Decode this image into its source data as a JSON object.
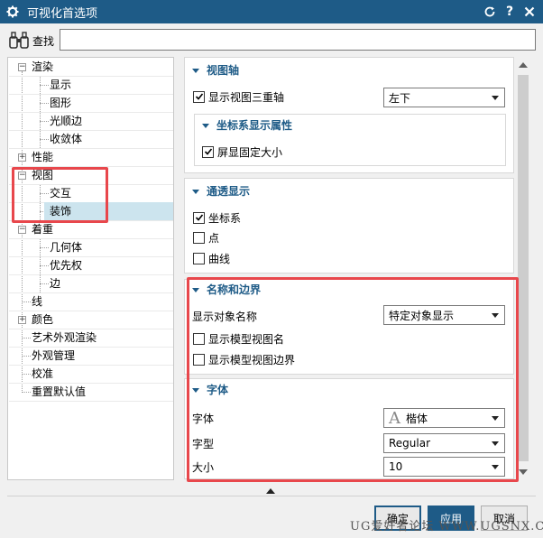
{
  "window": {
    "title": "可视化首选项"
  },
  "search": {
    "label": "查找",
    "value": "",
    "placeholder": ""
  },
  "tree": {
    "items": [
      {
        "label": "渲染"
      },
      {
        "label": "显示"
      },
      {
        "label": "图形"
      },
      {
        "label": "光顺边"
      },
      {
        "label": "收敛体"
      },
      {
        "label": "性能"
      },
      {
        "label": "视图"
      },
      {
        "label": "交互"
      },
      {
        "label": "装饰"
      },
      {
        "label": "着重"
      },
      {
        "label": "几何体"
      },
      {
        "label": "优先权"
      },
      {
        "label": "边"
      },
      {
        "label": "线"
      },
      {
        "label": "颜色"
      },
      {
        "label": "艺术外观渲染"
      },
      {
        "label": "外观管理"
      },
      {
        "label": "校准"
      },
      {
        "label": "重置默认值"
      }
    ]
  },
  "panel": {
    "view_triad": {
      "header": "视图轴",
      "show_triad_label": "显示视图三重轴",
      "position_value": "左下",
      "coord": {
        "header": "坐标系显示属性",
        "fixed_size_label": "屏显固定大小"
      }
    },
    "see_through": {
      "header": "通透显示",
      "csys_label": "坐标系",
      "point_label": "点",
      "curve_label": "曲线"
    },
    "names_borders": {
      "header": "名称和边界",
      "show_name_label": "显示对象名称",
      "show_name_value": "特定对象显示",
      "model_view_name_label": "显示模型视图名",
      "model_view_border_label": "显示模型视图边界"
    },
    "font": {
      "header": "字体",
      "font_label": "字体",
      "font_value": "楷体",
      "style_label": "字型",
      "style_value": "Regular",
      "size_label": "大小",
      "size_value": "10"
    }
  },
  "buttons": {
    "ok": "确定",
    "apply": "应用",
    "cancel": "取消"
  },
  "watermark": "UG爱好者论坛 WWW.UGSNX.COM",
  "colors": {
    "titlebar": "#1e5b87",
    "accent": "#1e5b87",
    "highlight_box": "#e8474c",
    "selection": "#cce4ee"
  }
}
